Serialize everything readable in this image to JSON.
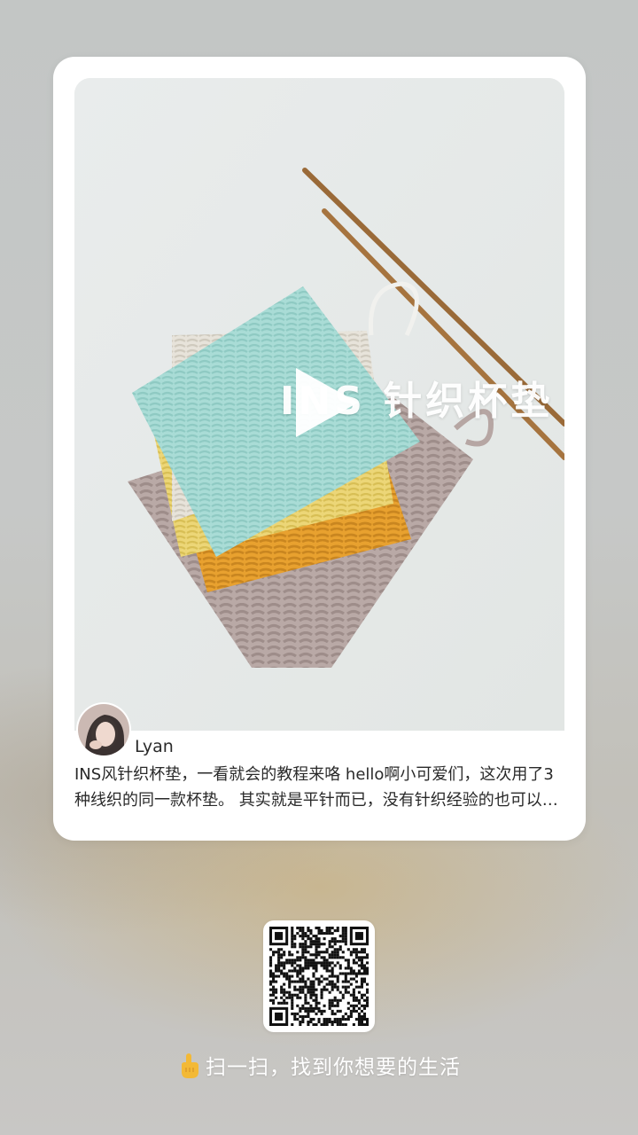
{
  "post": {
    "overlay_title": "INS 针织杯垫",
    "author": {
      "name": "Lyan"
    },
    "description": "INS风针织杯垫，一看就会的教程来咯 hello啊小可爱们，这次用了3种线织的同一款杯垫。 其实就是平针而已，没有针织经验的也可以试试哦"
  },
  "share": {
    "hint_text": "扫一扫，找到你想要的生活"
  },
  "icons": {
    "play": "play-icon",
    "hand": "pointing-hand-icon",
    "qr": "qr-code"
  },
  "colors": {
    "card_background": "#ffffff",
    "page_background": "#c4c6c5",
    "hint_text": "#ffffff",
    "body_text": "#2a2a2a"
  }
}
